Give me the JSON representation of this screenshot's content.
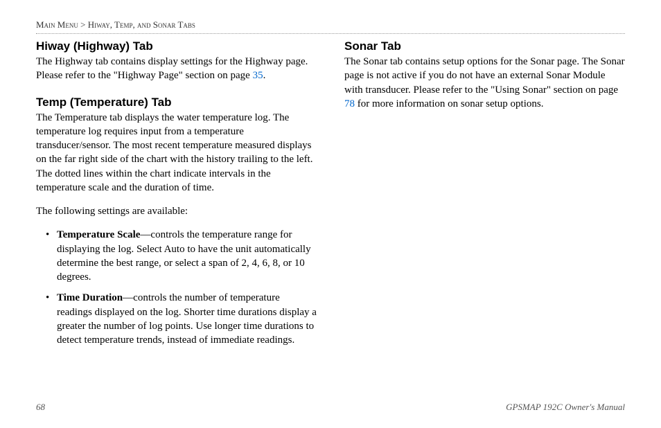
{
  "breadcrumb": {
    "main": "Main Menu",
    "sep": " > ",
    "sub": "Hiway, Temp, and Sonar Tabs"
  },
  "left": {
    "hiway": {
      "title": "Hiway (Highway) Tab",
      "body_a": "The Highway tab contains display settings for the Highway page. Please refer to the \"Highway Page\" section on page ",
      "page_link": "35",
      "body_b": "."
    },
    "temp": {
      "title": "Temp (Temperature) Tab",
      "body1": "The Temperature tab displays the water temperature log. The temperature log requires input from a temperature transducer/sensor. The most recent temperature measured displays on the far right side of the chart with the history trailing to the left. The dotted lines within the chart indicate intervals in the temperature scale and the duration of time.",
      "body2": "The following settings are available:",
      "items": [
        {
          "label": "Temperature Scale",
          "desc": "—controls the temperature range for displaying the log. Select Auto to have the unit automatically determine the best range, or select a span of 2, 4, 6, 8, or 10 degrees."
        },
        {
          "label": "Time Duration",
          "desc": "—controls the number of temperature readings displayed on the log. Shorter time durations display a greater the number of log points. Use longer time durations to detect temperature trends, instead of immediate readings."
        }
      ]
    }
  },
  "right": {
    "sonar": {
      "title": "Sonar Tab",
      "body_a": "The Sonar tab contains setup options for the Sonar page. The Sonar page is not active if you do not have an external Sonar Module with transducer. Please refer to the \"Using Sonar\" section on page ",
      "page_link": "78",
      "body_b": " for more information on sonar setup options."
    }
  },
  "footer": {
    "page": "68",
    "doc": "GPSMAP 192C Owner's Manual"
  }
}
